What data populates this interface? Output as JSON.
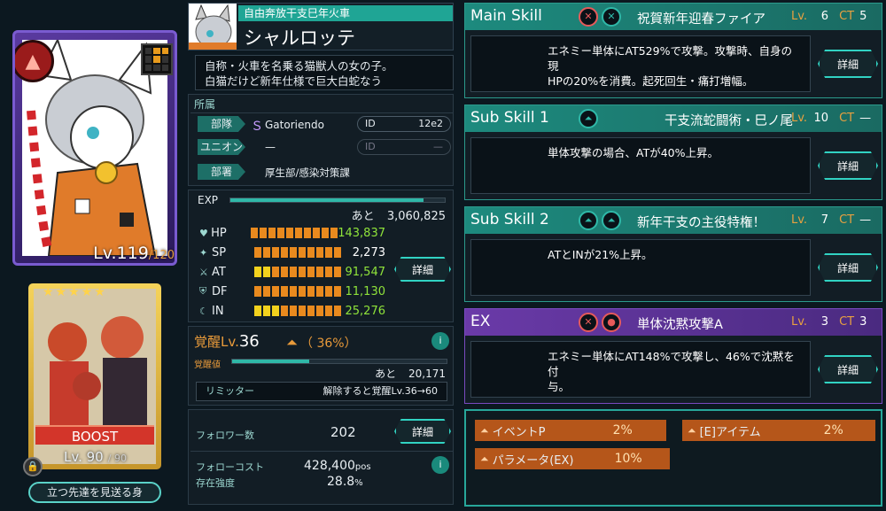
{
  "character": {
    "title": "自由奔放干支巳年火車",
    "name": "シャルロッテ",
    "description": [
      "自称・火車を名乗る猫獣人の女の子。",
      "白猫だけど新年仕様で巨大白蛇なう"
    ],
    "level": "Lv.119",
    "level_max": "/120"
  },
  "affiliation": {
    "header": "所属",
    "team_label": "部隊",
    "team_value": "Gatoriendo",
    "team_id_label": "ID",
    "team_id": "12e2",
    "union_label": "ユニオン",
    "union_value": "—",
    "union_id_label": "ID",
    "union_id": "—",
    "dept_label": "部署",
    "dept_value": "厚生部/感染対策課"
  },
  "stats": {
    "exp_label": "EXP",
    "exp_remaining_label": "あと",
    "exp_remaining": "3,060,825",
    "exp_fill": 0.9,
    "rows": [
      {
        "label": "HP",
        "value": "143,837",
        "yellow": 0
      },
      {
        "label": "SP",
        "value": "2,273",
        "yellow": 0
      },
      {
        "label": "AT",
        "value": "91,547",
        "yellow": 2
      },
      {
        "label": "DF",
        "value": "11,130",
        "yellow": 0
      },
      {
        "label": "IN",
        "value": "25,276",
        "yellow": 3
      }
    ],
    "detail_label": "詳細"
  },
  "awakening": {
    "label": "覚醒Lv.",
    "level": "36",
    "percent": "（ 36%）",
    "value_label": "覚醒値",
    "remaining_label": "あと",
    "remaining": "20,171",
    "fill": 0.36,
    "limiter_label": "リミッター",
    "limiter_value": "解除すると覚醒Lv.36→60"
  },
  "follow": {
    "followers_label": "フォロワー数",
    "followers": "202",
    "detail_label": "詳細",
    "cost_label": "フォローコスト",
    "cost": "428,400",
    "cost_unit": "pos",
    "strength_label": "存在強度",
    "strength": "28.8",
    "strength_unit": "%"
  },
  "support": {
    "boost_label": "BOOST",
    "level": "Lv. 90",
    "level_max": "/ 90",
    "footer": "立つ先達を見送る身"
  },
  "skills": [
    {
      "header": "Main Skill",
      "name": "祝賀新年迎春ファイア",
      "lv_label": "Lv.",
      "lv": "6",
      "ct_label": "CT",
      "ct": "5",
      "desc": [
        "エネミー単体にAT529%で攻撃。攻撃時、自身の現",
        "HPの20%を消費。起死回生・痛打増幅。"
      ],
      "detail": "詳細"
    },
    {
      "header": "Sub Skill 1",
      "name": "干支流蛇闘術・巳ノ尾",
      "lv_label": "Lv.",
      "lv": "10",
      "ct_label": "CT",
      "ct": "—",
      "desc": [
        "単体攻撃の場合、ATが40%上昇。"
      ],
      "detail": "詳細"
    },
    {
      "header": "Sub Skill 2",
      "name": "新年干支の主役特権！",
      "lv_label": "Lv.",
      "lv": "7",
      "ct_label": "CT",
      "ct": "—",
      "desc": [
        "ATとINが21%上昇。"
      ],
      "detail": "詳細"
    },
    {
      "header": "EX",
      "name": "単体沈黙攻撃A",
      "lv_label": "Lv.",
      "lv": "3",
      "ct_label": "CT",
      "ct": "3",
      "desc": [
        "エネミー単体にAT148%で攻撃し、46%で沈黙を付",
        "与。"
      ],
      "detail": "詳細"
    }
  ],
  "bonuses": [
    {
      "label": "イベントP",
      "value": "2%"
    },
    {
      "label": "[E]アイテム",
      "value": "2%"
    },
    {
      "label": "パラメータ(EX)",
      "value": "10%"
    }
  ]
}
